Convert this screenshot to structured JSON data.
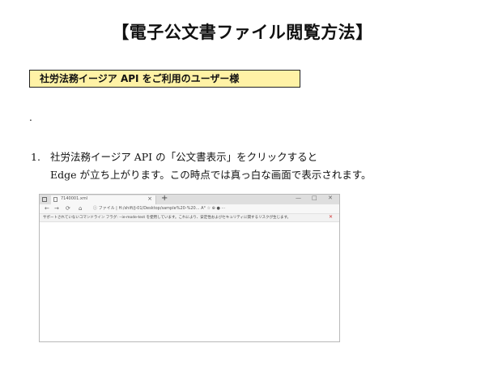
{
  "document": {
    "title": "【電子公文書ファイル閲覧方法】",
    "audience_label": "社労法務イージア API をご利用のユーザー様",
    "dot": "."
  },
  "steps": [
    {
      "number": "1.",
      "line1": "社労法務イージア API の「公文書表示」をクリックすると",
      "line2": "Edge が立ち上がります。この時点では真っ白な画面で表示されます。"
    }
  ],
  "screenshot": {
    "tab_title": "7140001.xml",
    "tab_close": "×",
    "new_tab": "+",
    "window_controls": [
      "—",
      "□",
      "✕"
    ],
    "nav_icons": [
      "←",
      "→",
      "⟳",
      "⌂"
    ],
    "address": "ⓘ ファイル | H:/shift/J-01/Desktop/sample%20-%20... A° ☆ ⊕ ● ···",
    "compat_message": "サポートされていないコマンドライン フラグ: --ie-mode-test を使用しています。これにより、安定性およびセキュリティに関するリスクが生じます。",
    "compat_close": "✕",
    "icons": {
      "tab_page": "page-icon",
      "sidebar": "square-icon"
    }
  }
}
